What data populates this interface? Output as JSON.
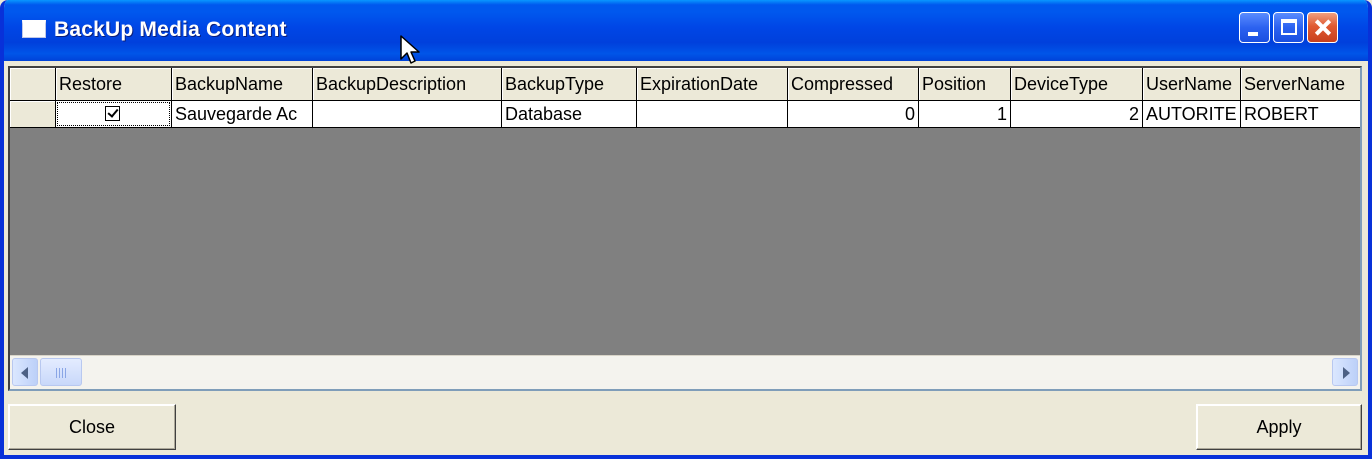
{
  "window": {
    "title": "BackUp Media Content",
    "controls": [
      "minimize-icon",
      "maximize-icon",
      "close-icon"
    ]
  },
  "grid": {
    "columns": [
      "",
      "Restore",
      "BackupName",
      "BackupDescription",
      "BackupType",
      "ExpirationDate",
      "Compressed",
      "Position",
      "DeviceType",
      "UserName",
      "ServerName"
    ],
    "rows": [
      {
        "restore_checked": true,
        "BackupName": "Sauvegarde Ac",
        "BackupDescription": "",
        "BackupType": "Database",
        "ExpirationDate": "",
        "Compressed": "0",
        "Position": "1",
        "DeviceType": "2",
        "UserName": "AUTORITE",
        "ServerName": "ROBERT"
      }
    ]
  },
  "buttons": {
    "close_label": "Close",
    "apply_label": "Apply"
  }
}
